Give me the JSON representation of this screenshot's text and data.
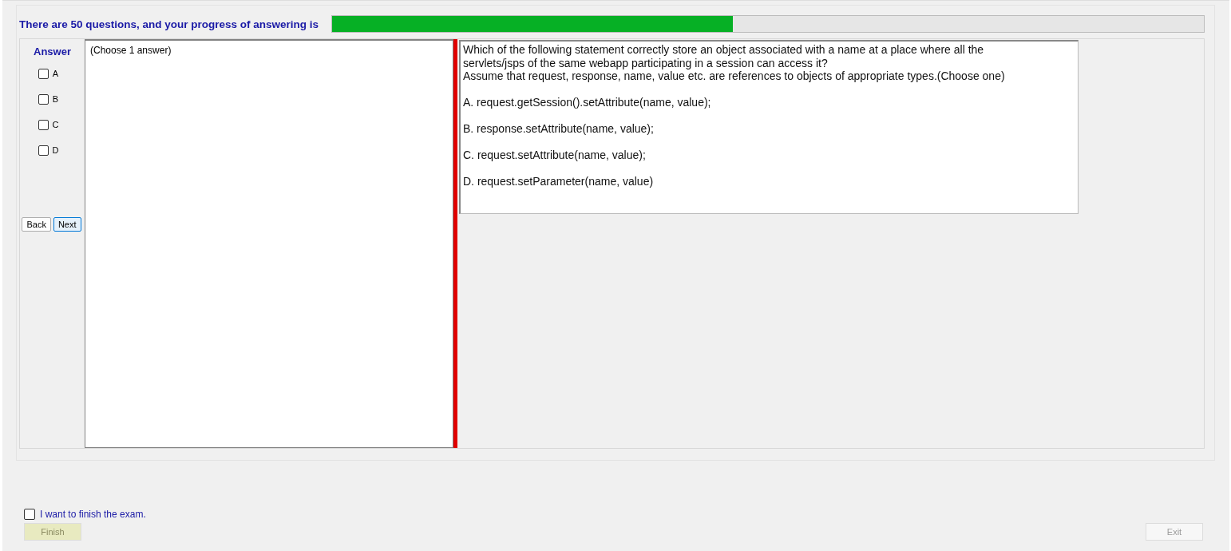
{
  "header": {
    "text": "There are 50 questions, and your progress of answering is",
    "progress": {
      "level": 0.46
    }
  },
  "answer": {
    "title": "Answer",
    "options": [
      {
        "label": "A",
        "checked": false
      },
      {
        "label": "B",
        "checked": false
      },
      {
        "label": "C",
        "checked": false
      },
      {
        "label": "D",
        "checked": false
      }
    ]
  },
  "navigation": [
    {
      "label": "Back",
      "selected": false
    },
    {
      "label": "Next",
      "selected": true
    }
  ],
  "instruction": "(Choose 1 answer)",
  "question": {
    "lines": [
      "Which of the following statement correctly store an object associated with a name at a place where all the",
      "servlets/jsps of the same webapp participating in a session can access it?",
      "Assume that request, response, name, value etc. are references to objects of appropriate types.(Choose one)"
    ],
    "choices": [
      "A.  request.getSession().setAttribute(name, value);",
      "B.  response.setAttribute(name, value);",
      "C.  request.setAttribute(name, value);",
      "D.  request.setParameter(name, value)"
    ]
  },
  "finish": {
    "label": "I want to finish the exam.",
    "checked": false,
    "button": {
      "label": "Finish",
      "disabled": true
    }
  },
  "exit": {
    "label": "Exit",
    "disabled": true
  }
}
